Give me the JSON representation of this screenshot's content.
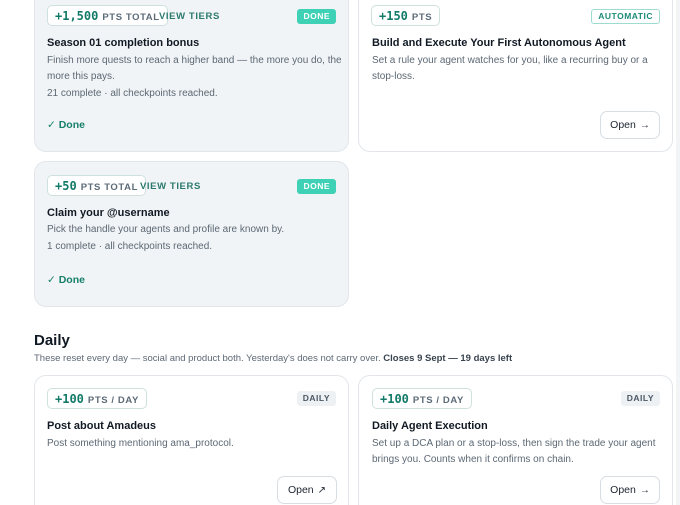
{
  "cards": {
    "season_bonus": {
      "points": "+1,500",
      "unit": "PTS TOTAL",
      "view_tiers": "VIEW TIERS",
      "badge": "DONE",
      "title": "Season 01 completion bonus",
      "description": "Finish more quests to reach a higher band — the more you do, the more this pays.",
      "progress": "21 complete · all checkpoints reached.",
      "done_label": "✓ Done"
    },
    "autonomous_agent": {
      "points": "+150",
      "unit": "PTS",
      "badge": "AUTOMATIC",
      "title": "Build and Execute Your First Autonomous Agent",
      "description": "Set a rule your agent watches for you, like a recurring buy or a stop-loss.",
      "open_label": "Open",
      "open_icon": "→"
    },
    "claim_username": {
      "points": "+50",
      "unit": "PTS TOTAL",
      "view_tiers": "VIEW TIERS",
      "badge": "DONE",
      "title": "Claim your @username",
      "description": "Pick the handle your agents and profile are known by.",
      "progress": "1 complete · all checkpoints reached.",
      "done_label": "✓ Done"
    },
    "post_amadeus": {
      "points": "+100",
      "unit": "PTS / DAY",
      "badge": "DAILY",
      "title": "Post about Amadeus",
      "description": "Post something mentioning ama_protocol.",
      "open_label": "Open",
      "open_icon": "↗"
    },
    "daily_agent": {
      "points": "+100",
      "unit": "PTS / DAY",
      "badge": "DAILY",
      "title": "Daily Agent Execution",
      "description": "Set up a DCA plan or a stop-loss, then sign the trade your agent brings you. Counts when it confirms on chain.",
      "open_label": "Open",
      "open_icon": "→"
    }
  },
  "daily_section": {
    "heading": "Daily",
    "subtitle": "These reset every day — social and product both. Yesterday's does not carry over.",
    "closes": "Closes 9 Sept — 19 days left"
  }
}
